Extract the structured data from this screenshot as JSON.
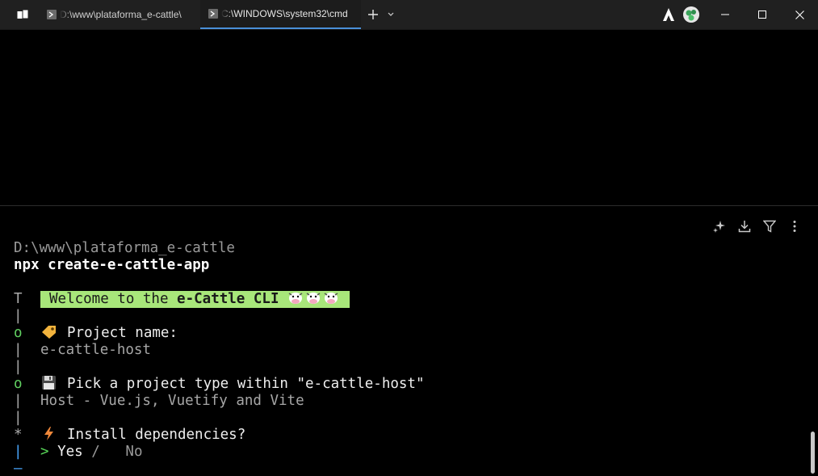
{
  "window": {
    "tabs": [
      {
        "title": "D:\\www\\plataforma_e-cattle\\",
        "active": false
      },
      {
        "title": "C:\\WINDOWS\\system32\\cmd",
        "active": true
      }
    ],
    "new_tab_icon": "plus-icon",
    "dropdown_icon": "chevron-down-icon",
    "buttons": {
      "minimize_icon": "minimize-icon",
      "maximize_icon": "maximize-icon",
      "close_icon": "close-icon"
    },
    "accent_color": "#4a90d9"
  },
  "pane_tools": [
    "sparkle-icon",
    "download-icon",
    "filter-icon",
    "more-vertical-icon"
  ],
  "terminal": {
    "cwd": "D:\\www\\plataforma_e-cattle",
    "command": "npx create-e-cattle-app",
    "welcome_prefix": "Welcome to the ",
    "welcome_brand": "e-Cattle CLI",
    "welcome_badge_color": "#a8e67a",
    "gutter": {
      "start": "T",
      "bar": "|",
      "done": "o",
      "active": "*",
      "end": "—"
    },
    "q1_label": "Project name:",
    "q1_icon": "tag-icon",
    "q1_answer": "e-cattle-host",
    "q2_label": "Pick a project type within \"e-cattle-host\"",
    "q2_icon": "floppy-disk-icon",
    "q2_answer": "Host - Vue.js, Vuetify and Vite",
    "q3_label": "Install dependencies?",
    "q3_icon": "lightning-icon",
    "q3_cursor": ">",
    "q3_yes": "Yes",
    "q3_sep": "/",
    "q3_no": "No"
  }
}
